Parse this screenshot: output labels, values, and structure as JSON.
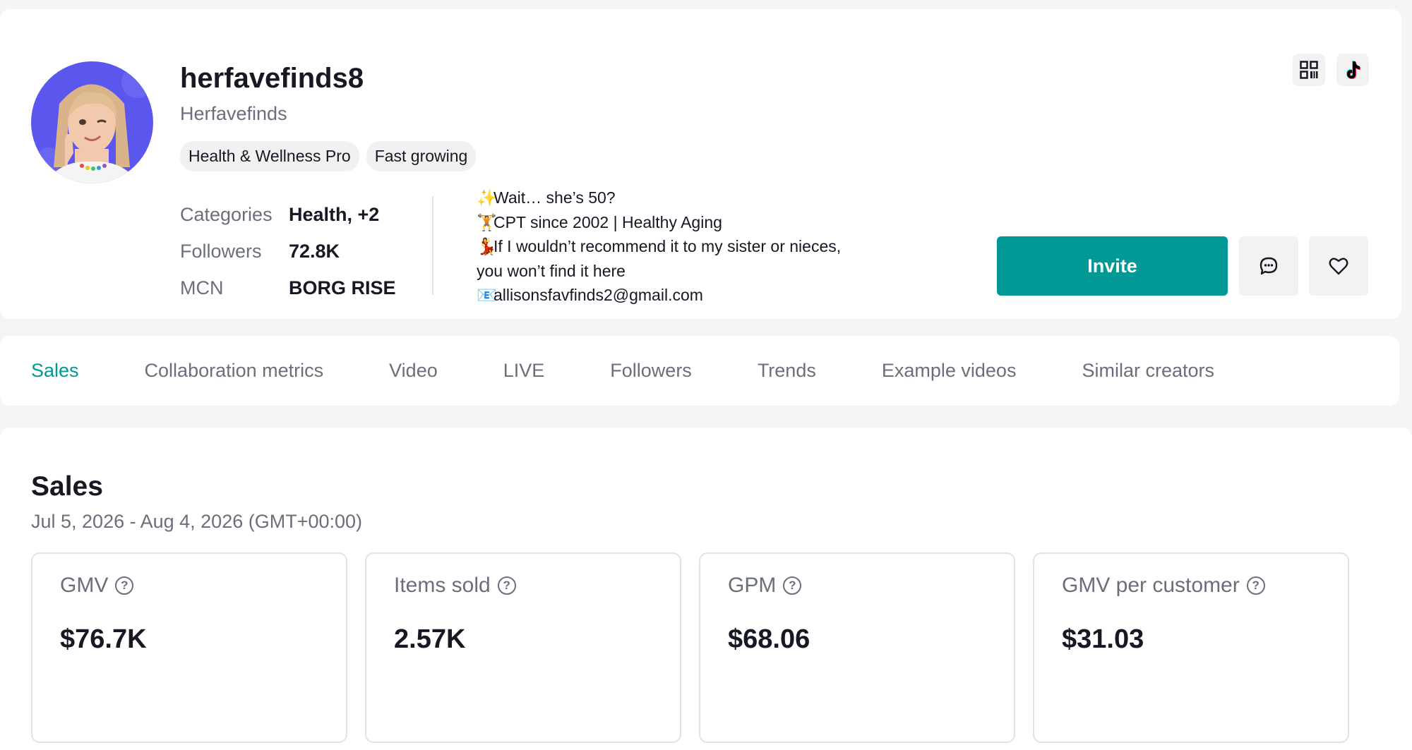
{
  "profile": {
    "username": "herfavefinds8",
    "nickname": "Herfavefinds",
    "badges": [
      "Health & Wellness Pro",
      "Fast growing"
    ],
    "meta": [
      {
        "label": "Categories",
        "value": "Health, +2"
      },
      {
        "label": "Followers",
        "value": "72.8K"
      },
      {
        "label": "MCN",
        "value": "BORG RISE"
      }
    ],
    "bio": {
      "lines": [
        {
          "emoji": "✨",
          "text": "Wait… she’s 50?"
        },
        {
          "emoji": "🏋",
          "text": "CPT since 2002 | Healthy Aging"
        },
        {
          "emoji": "💃",
          "text": "If I wouldn’t recommend it to my sister or nieces,"
        },
        {
          "emoji": "",
          "text": "you won’t find it here"
        },
        {
          "emoji": "📧",
          "text": "allisonsfavfinds2@gmail.com"
        }
      ]
    },
    "invite_label": "Invite",
    "top_icons": [
      "qr-code-icon",
      "tiktok-icon"
    ]
  },
  "tabs": [
    {
      "label": "Sales",
      "active": true
    },
    {
      "label": "Collaboration metrics"
    },
    {
      "label": "Video"
    },
    {
      "label": "LIVE"
    },
    {
      "label": "Followers"
    },
    {
      "label": "Trends"
    },
    {
      "label": "Example videos"
    },
    {
      "label": "Similar creators"
    }
  ],
  "sales": {
    "title": "Sales",
    "date_range": "Jul 5, 2026 - Aug 4, 2026 (GMT+00:00)",
    "metrics": [
      {
        "label": "GMV",
        "value": "$76.7K"
      },
      {
        "label": "Items sold",
        "value": "2.57K"
      },
      {
        "label": "GPM",
        "value": "$68.06"
      },
      {
        "label": "GMV per customer",
        "value": "$31.03"
      }
    ]
  },
  "colors": {
    "accent": "#009995",
    "avatar_bg": "#5b57ee",
    "text_primary": "#161823",
    "text_secondary": "#6b6f7b"
  }
}
